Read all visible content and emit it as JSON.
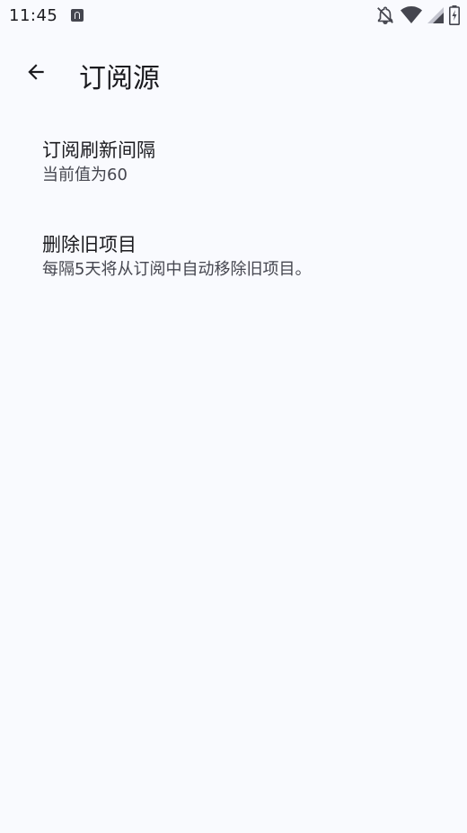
{
  "status_bar": {
    "time": "11:45",
    "icons": [
      "font-a-notification-icon",
      "bell-off-icon",
      "wifi-icon",
      "signal-icon",
      "battery-charging-icon"
    ]
  },
  "app_bar": {
    "title": "订阅源",
    "back_icon": "arrow-back-icon"
  },
  "preferences": [
    {
      "title": "订阅刷新间隔",
      "summary": "当前值为60"
    },
    {
      "title": "删除旧项目",
      "summary": "每隔5天将从订阅中自动移除旧项目。"
    }
  ],
  "colors": {
    "background": "#f9fafe",
    "primary_text": "#1b1b1f",
    "secondary_text": "#45464f"
  }
}
